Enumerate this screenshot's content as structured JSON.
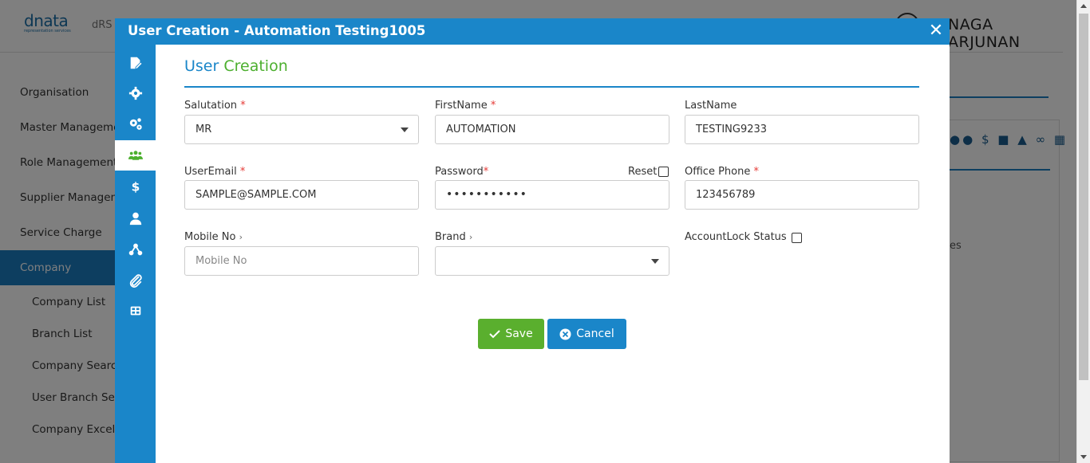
{
  "app": {
    "logo": "dnata",
    "logo_tagline": "representation services",
    "app_name": "dRS",
    "user_name": "NAGA ARJUNAN"
  },
  "sidebar": {
    "items": [
      {
        "label": "Organisation"
      },
      {
        "label": "Master Management"
      },
      {
        "label": "Role Management"
      },
      {
        "label": "Supplier Management"
      },
      {
        "label": "Service Charge"
      },
      {
        "label": "Company",
        "active": true
      }
    ],
    "sub_items": [
      {
        "label": "Company List"
      },
      {
        "label": "Branch List"
      },
      {
        "label": "Company Search"
      },
      {
        "label": "User Branch Search"
      },
      {
        "label": "Company Excel"
      }
    ]
  },
  "background": {
    "partial_text": "es",
    "icon_names": [
      "users-icon",
      "dollar-icon",
      "user-icon",
      "sitemap-icon",
      "paperclip-icon",
      "grid-icon"
    ]
  },
  "modal": {
    "title": "User Creation - Automation Testing1005",
    "close_symbol": "✕",
    "nav_icons": [
      "edit-icon",
      "cog-icon",
      "cogs-icon",
      "users-icon",
      "dollar-icon",
      "user-icon",
      "sitemap-icon",
      "paperclip-icon",
      "grid-icon"
    ],
    "active_nav": "users-icon",
    "form": {
      "title_part1": "User",
      "title_part2": "Creation",
      "salutation": {
        "label": "Salutation",
        "required": "*",
        "value": "MR"
      },
      "first_name": {
        "label": "FirstName",
        "required": "*",
        "value": "AUTOMATION"
      },
      "last_name": {
        "label": "LastName",
        "value": "TESTING9233"
      },
      "user_email": {
        "label": "UserEmail",
        "required": "*",
        "value": "SAMPLE@SAMPLE.COM"
      },
      "password": {
        "label": "Password",
        "required": "*",
        "value": "•••••••••••",
        "reset_label": "Reset"
      },
      "office_phone": {
        "label": "Office Phone",
        "required": "*",
        "value": "123456789"
      },
      "mobile_no": {
        "label": "Mobile No",
        "chevron": "›",
        "placeholder": "Mobile No"
      },
      "brand": {
        "label": "Brand",
        "chevron": "›",
        "value": ""
      },
      "account_lock": {
        "label": "AccountLock Status"
      }
    },
    "buttons": {
      "save": "Save",
      "cancel": "Cancel"
    }
  },
  "colors": {
    "primary": "#1a86c9",
    "accent_green": "#4caf2e",
    "save_green": "#5aaf2e",
    "required_red": "#e53935"
  }
}
